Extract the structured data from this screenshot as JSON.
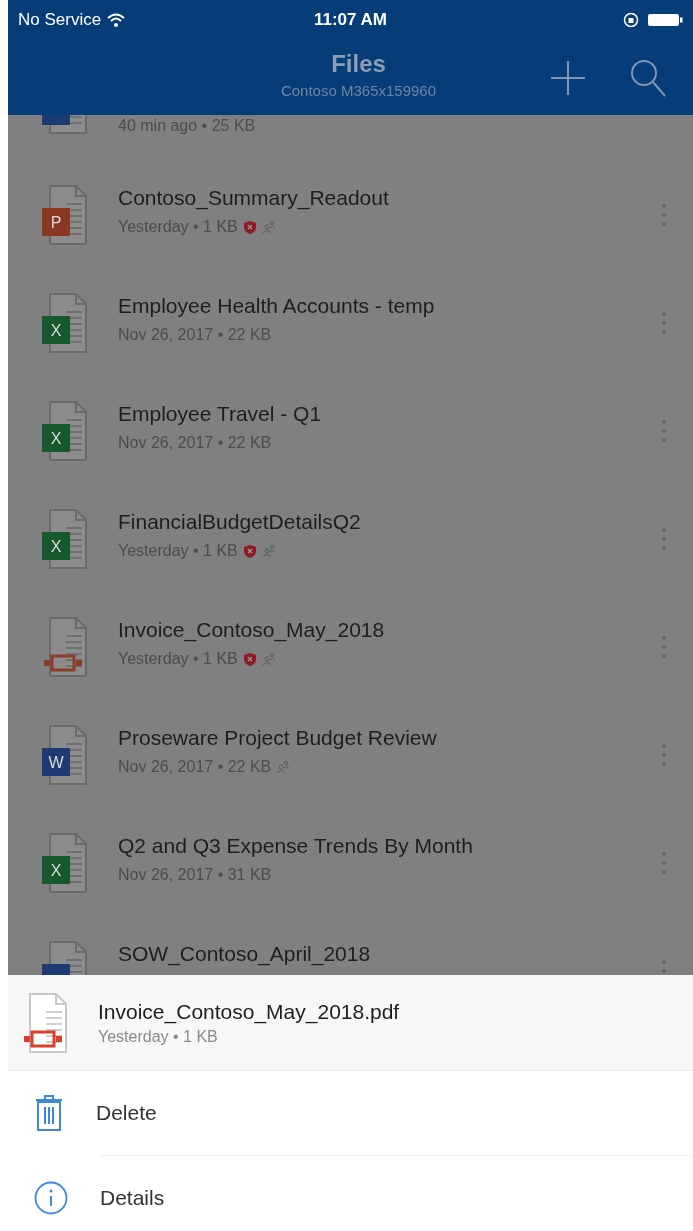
{
  "status_bar": {
    "carrier": "No Service",
    "time": "11:07 AM"
  },
  "header": {
    "title": "Files",
    "subtitle": "Contoso M365x159960"
  },
  "files": [
    {
      "kind": "word",
      "meta": "40 min ago • 25 KB",
      "protected": false,
      "shared": false
    },
    {
      "kind": "powerpoint",
      "letter": "P",
      "name": "Contoso_Summary_Readout",
      "meta": "Yesterday • 1 KB",
      "protected": true,
      "shared": true
    },
    {
      "kind": "excel",
      "letter": "X",
      "name": "Employee Health Accounts - temp",
      "meta": "Nov 26, 2017 • 22 KB",
      "protected": false,
      "shared": false
    },
    {
      "kind": "excel",
      "letter": "X",
      "name": "Employee Travel - Q1",
      "meta": "Nov 26, 2017 • 22 KB",
      "protected": false,
      "shared": false
    },
    {
      "kind": "excel",
      "letter": "X",
      "name": "FinancialBudgetDetailsQ2",
      "meta": "Yesterday • 1 KB",
      "protected": true,
      "shared": true
    },
    {
      "kind": "pdf",
      "name": "Invoice_Contoso_May_2018",
      "meta": "Yesterday • 1 KB",
      "protected": true,
      "shared": true
    },
    {
      "kind": "word",
      "letter": "W",
      "name": "Proseware Project Budget Review",
      "meta": "Nov 26, 2017 • 22 KB",
      "protected": false,
      "shared": true
    },
    {
      "kind": "excel",
      "letter": "X",
      "name": "Q2 and Q3 Expense Trends By Month",
      "meta": "Nov 26, 2017 • 31 KB",
      "protected": false,
      "shared": false
    },
    {
      "kind": "word",
      "name": "SOW_Contoso_April_2018"
    }
  ],
  "sheet": {
    "file": {
      "kind": "pdf",
      "name": "Invoice_Contoso_May_2018.pdf",
      "meta": "Yesterday • 1 KB"
    },
    "actions": [
      {
        "kind": "delete",
        "label": "Delete"
      },
      {
        "kind": "details",
        "label": "Details"
      }
    ]
  }
}
